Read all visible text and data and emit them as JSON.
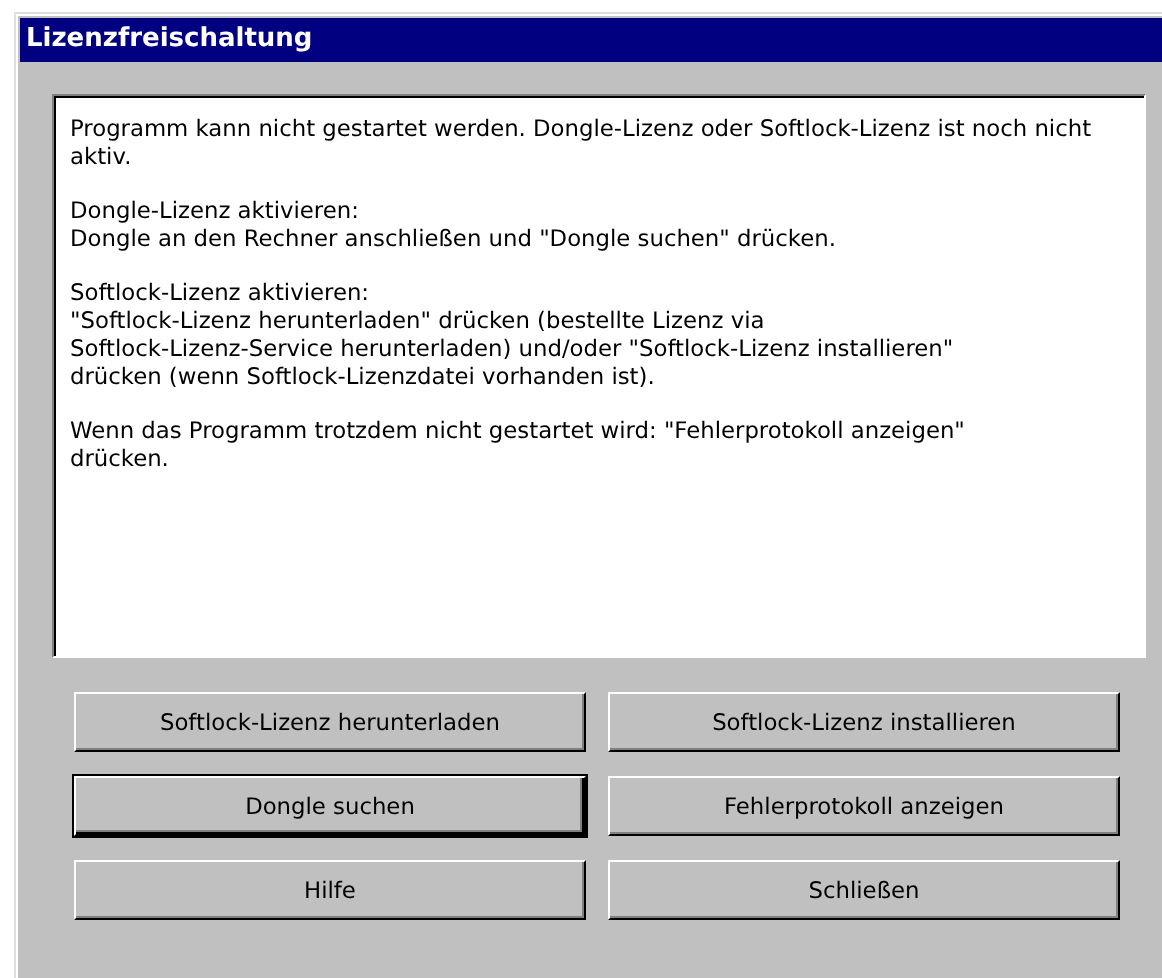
{
  "window": {
    "title": "Lizenzfreischaltung"
  },
  "message": [
    "Programm kann nicht gestartet werden. Dongle-Lizenz oder Softlock-Lizenz ist noch nicht aktiv.",
    "Dongle-Lizenz aktivieren:\nDongle an den Rechner anschließen und \"Dongle suchen\" drücken.",
    "Softlock-Lizenz aktivieren:\n\"Softlock-Lizenz herunterladen\" drücken (bestellte Lizenz via\nSoftlock-Lizenz-Service herunterladen) und/oder \"Softlock-Lizenz installieren\"\ndrücken (wenn Softlock-Lizenzdatei vorhanden ist).",
    "Wenn das Programm trotzdem nicht gestartet wird: \"Fehlerprotokoll anzeigen\"\ndrücken."
  ],
  "buttons": [
    {
      "label": "Softlock-Lizenz herunterladen",
      "default": false
    },
    {
      "label": "Softlock-Lizenz installieren",
      "default": false
    },
    {
      "label": "Dongle suchen",
      "default": true
    },
    {
      "label": "Fehlerprotokoll anzeigen",
      "default": false
    },
    {
      "label": "Hilfe",
      "default": false
    },
    {
      "label": "Schließen",
      "default": false
    }
  ]
}
